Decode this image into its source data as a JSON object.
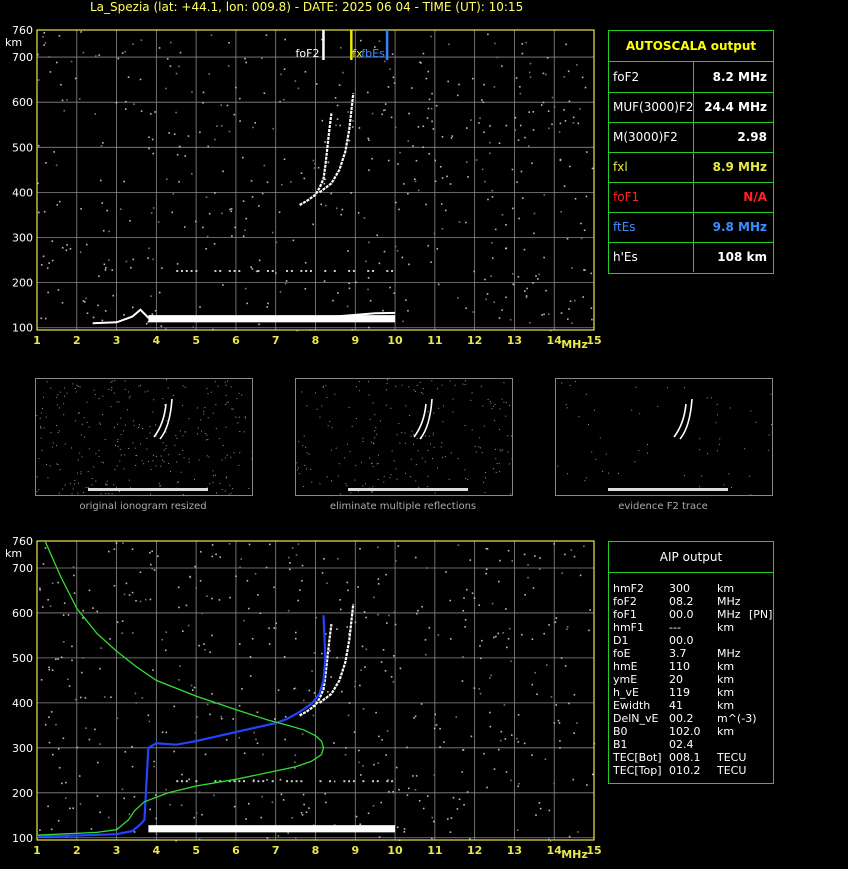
{
  "title": "La_Spezia (lat: +44.1, lon: 009.8) - DATE: 2025 06 04 - TIME (UT): 10:15",
  "colors": {
    "axis": "#e8e84a",
    "grid": "#888888",
    "panel_border": "#22cc22",
    "trace": "#ffffff",
    "f2_marker": "#ffffff",
    "fxl_marker": "#e8e800",
    "ftes_marker": "#3a7fff",
    "profile": "#33dd33",
    "aip_trace": "#2244ff"
  },
  "markers": {
    "foF2": "foF2",
    "fxl": "fx",
    "fbEs": "fbEs"
  },
  "autoscala": {
    "title": "AUTOSCALA output",
    "rows": [
      {
        "label": "foF2",
        "value": "8.2 MHz",
        "label_color": "#ffffff",
        "value_color": "#ffffff"
      },
      {
        "label": "MUF(3000)F2",
        "value": "24.4 MHz",
        "label_color": "#ffffff",
        "value_color": "#ffffff"
      },
      {
        "label": "M(3000)F2",
        "value": "2.98",
        "label_color": "#ffffff",
        "value_color": "#ffffff"
      },
      {
        "label": "fxl",
        "value": "8.9 MHz",
        "label_color": "#e8e84a",
        "value_color": "#e8e84a"
      },
      {
        "label": "foF1",
        "value": "N/A",
        "label_color": "#ff2020",
        "value_color": "#ff2020"
      },
      {
        "label": "ftEs",
        "value": "9.8 MHz",
        "label_color": "#3a8fff",
        "value_color": "#3a8fff"
      },
      {
        "label": "h'Es",
        "value": "108     km",
        "label_color": "#ffffff",
        "value_color": "#ffffff"
      }
    ]
  },
  "aip": {
    "title": "AIP output",
    "rows": [
      {
        "k": "hmF2",
        "v": "300",
        "u": "km",
        "x": ""
      },
      {
        "k": "foF2",
        "v": "08.2",
        "u": "MHz",
        "x": ""
      },
      {
        "k": "foF1",
        "v": "00.0",
        "u": "MHz",
        "x": "[PN]"
      },
      {
        "k": "hmF1",
        "v": "---",
        "u": "km",
        "x": ""
      },
      {
        "k": "D1",
        "v": "00.0",
        "u": "",
        "x": ""
      },
      {
        "k": "foE",
        "v": "3.7",
        "u": "MHz",
        "x": ""
      },
      {
        "k": "hmE",
        "v": "110",
        "u": "km",
        "x": ""
      },
      {
        "k": "ymE",
        "v": "20",
        "u": "km",
        "x": ""
      },
      {
        "k": "h_vE",
        "v": "119",
        "u": "km",
        "x": ""
      },
      {
        "k": "Ewidth",
        "v": "41",
        "u": "km",
        "x": ""
      },
      {
        "k": "DelN_vE",
        "v": "00.2",
        "u": "m^(-3)",
        "x": ""
      },
      {
        "k": "B0",
        "v": "102.0",
        "u": "km",
        "x": ""
      },
      {
        "k": "B1",
        "v": "02.4",
        "u": "",
        "x": ""
      },
      {
        "k": "TEC[Bot]",
        "v": "008.1",
        "u": "TECU",
        "x": ""
      },
      {
        "k": "TEC[Top]",
        "v": "010.2",
        "u": "TECU",
        "x": ""
      }
    ]
  },
  "thumbnails": [
    {
      "caption": "original ionogram resized"
    },
    {
      "caption": "eliminate multiple reflections"
    },
    {
      "caption": "evidence F2 trace"
    }
  ],
  "chart_data": [
    {
      "type": "scatter",
      "xlabel": "MHz",
      "ylabel": "km",
      "xlim": [
        1,
        15
      ],
      "ylim": [
        95,
        760
      ],
      "xticks": [
        1,
        2,
        3,
        4,
        5,
        6,
        7,
        8,
        9,
        10,
        11,
        12,
        13,
        14,
        15
      ],
      "yticks": [
        100,
        200,
        300,
        400,
        500,
        600,
        700,
        760
      ],
      "grid": true,
      "series": [
        {
          "points": [
            [
              7.6,
              372
            ],
            [
              7.8,
              382
            ],
            [
              8.0,
              395
            ],
            [
              8.1,
              410
            ],
            [
              8.2,
              430
            ],
            [
              8.25,
              460
            ],
            [
              8.3,
              500
            ],
            [
              8.35,
              540
            ],
            [
              8.4,
              575
            ]
          ]
        },
        {
          "points": [
            [
              8.1,
              400
            ],
            [
              8.4,
              420
            ],
            [
              8.6,
              450
            ],
            [
              8.75,
              490
            ],
            [
              8.85,
              540
            ],
            [
              8.9,
              580
            ],
            [
              8.95,
              620
            ]
          ]
        },
        {
          "points": [
            [
              2.4,
              110
            ],
            [
              3.0,
              112
            ],
            [
              3.4,
              125
            ],
            [
              3.6,
              140
            ],
            [
              3.8,
              122
            ],
            [
              4.5,
              120
            ],
            [
              6.0,
              120
            ],
            [
              7.5,
              120
            ],
            [
              8.5,
              125
            ],
            [
              9.5,
              132
            ],
            [
              10.0,
              133
            ]
          ]
        }
      ],
      "markers": {
        "foF2": 8.2,
        "fxl": 8.9,
        "ftEs": 9.8
      }
    },
    {
      "type": "line",
      "xlabel": "MHz",
      "ylabel": "km",
      "xlim": [
        1,
        15
      ],
      "ylim": [
        95,
        760
      ],
      "xticks": [
        1,
        2,
        3,
        4,
        5,
        6,
        7,
        8,
        9,
        10,
        11,
        12,
        13,
        14,
        15
      ],
      "yticks": [
        100,
        200,
        300,
        400,
        500,
        600,
        700,
        760
      ],
      "grid": true,
      "series": [
        {
          "points": [
            [
              1.2,
              760
            ],
            [
              1.6,
              680
            ],
            [
              2.0,
              610
            ],
            [
              2.5,
              555
            ],
            [
              3.0,
              515
            ],
            [
              3.5,
              480
            ],
            [
              4.0,
              450
            ],
            [
              5.0,
              415
            ],
            [
              6.0,
              385
            ],
            [
              6.8,
              362
            ],
            [
              7.3,
              350
            ],
            [
              7.7,
              340
            ],
            [
              8.0,
              327
            ],
            [
              8.15,
              315
            ],
            [
              8.2,
              300
            ],
            [
              8.15,
              285
            ],
            [
              7.9,
              270
            ],
            [
              7.5,
              258
            ],
            [
              6.8,
              245
            ],
            [
              6.0,
              230
            ],
            [
              5.0,
              215
            ],
            [
              4.3,
              200
            ],
            [
              3.7,
              180
            ],
            [
              3.45,
              160
            ],
            [
              3.3,
              140
            ],
            [
              3.0,
              118
            ],
            [
              2.5,
              112
            ],
            [
              1.0,
              106
            ]
          ]
        },
        {
          "points": [
            [
              1.0,
              103
            ],
            [
              2.0,
              105
            ],
            [
              3.0,
              108
            ],
            [
              3.4,
              115
            ],
            [
              3.6,
              130
            ],
            [
              3.7,
              140
            ],
            [
              3.75,
              220
            ],
            [
              3.8,
              300
            ],
            [
              4.0,
              310
            ],
            [
              4.5,
              307
            ],
            [
              5.0,
              315
            ],
            [
              5.5,
              325
            ],
            [
              6.0,
              335
            ],
            [
              6.5,
              345
            ],
            [
              7.0,
              355
            ],
            [
              7.3,
              365
            ],
            [
              7.6,
              380
            ],
            [
              7.9,
              398
            ],
            [
              8.1,
              420
            ],
            [
              8.2,
              450
            ],
            [
              8.25,
              500
            ],
            [
              8.2,
              595
            ]
          ]
        },
        {
          "points": [
            [
              7.6,
              372
            ],
            [
              7.8,
              382
            ],
            [
              8.0,
              395
            ],
            [
              8.1,
              410
            ],
            [
              8.2,
              430
            ],
            [
              8.25,
              460
            ],
            [
              8.3,
              500
            ],
            [
              8.35,
              540
            ],
            [
              8.4,
              575
            ]
          ]
        },
        {
          "points": [
            [
              8.1,
              400
            ],
            [
              8.4,
              420
            ],
            [
              8.6,
              450
            ],
            [
              8.75,
              490
            ],
            [
              8.85,
              540
            ],
            [
              8.9,
              580
            ],
            [
              8.95,
              620
            ]
          ]
        }
      ]
    }
  ]
}
